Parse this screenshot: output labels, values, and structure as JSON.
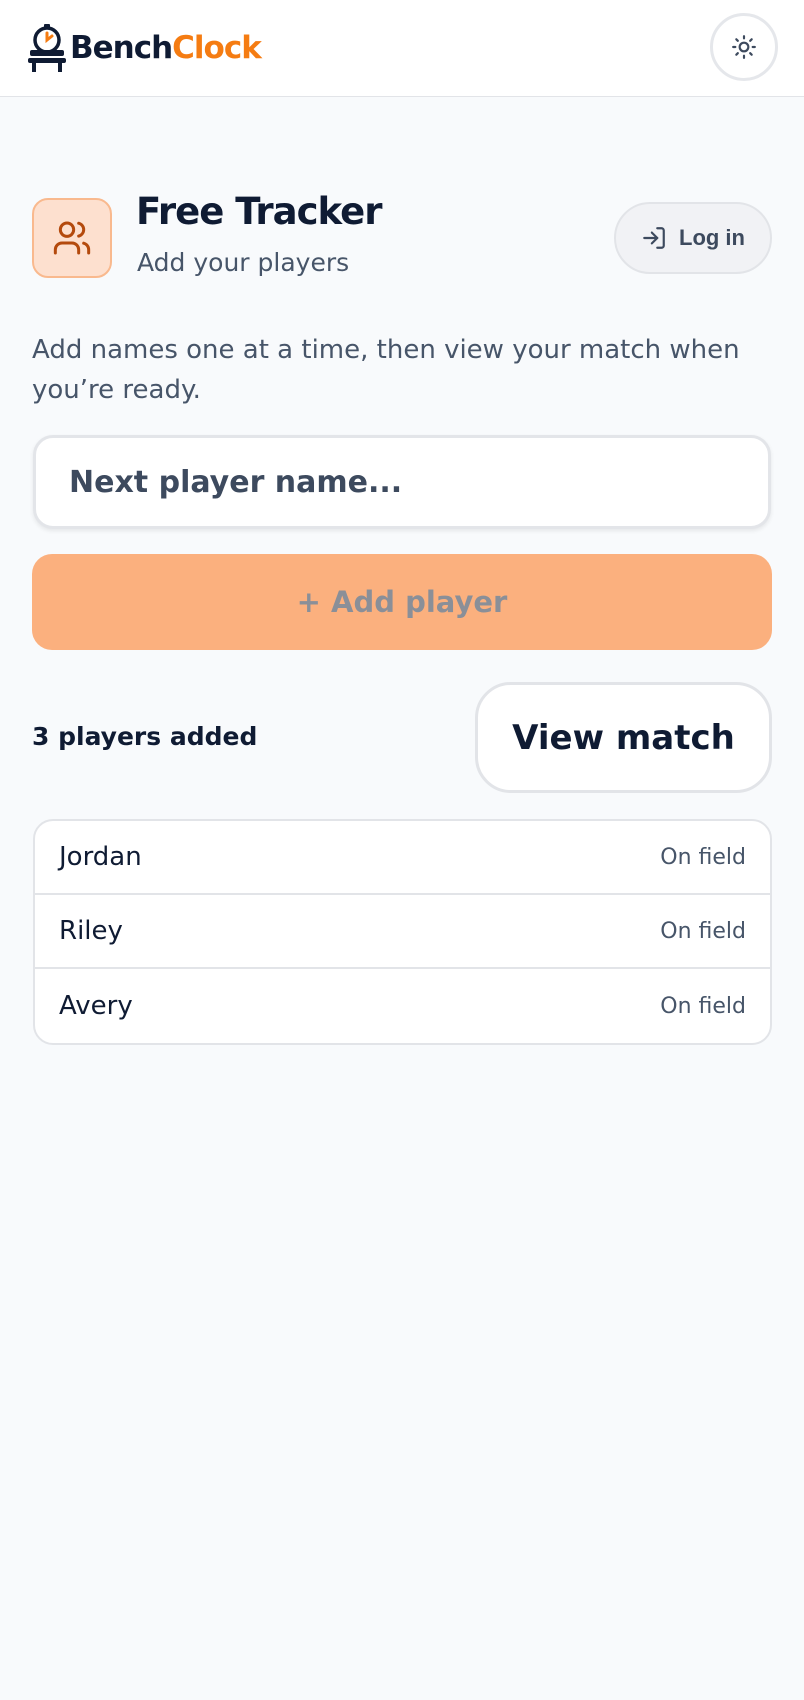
{
  "brand": {
    "part1": "Bench",
    "part2": "Clock"
  },
  "header": {
    "title": "Free Tracker",
    "subtitle": "Add your players",
    "login_label": "Log in"
  },
  "instructions": "Add names one at a time, then view your match when you’re ready.",
  "input": {
    "placeholder": "Next player name...",
    "value": ""
  },
  "add_button_label": "+ Add player",
  "player_count_label": "3 players added",
  "view_match_label": "View match",
  "players": [
    {
      "name": "Jordan",
      "status": "On field"
    },
    {
      "name": "Riley",
      "status": "On field"
    },
    {
      "name": "Avery",
      "status": "On field"
    }
  ],
  "colors": {
    "brand_dark": "#0f1b33",
    "brand_orange": "#f57c12",
    "add_button_bg": "#fbb07e",
    "tracker_icon_bg": "#fde0cf"
  },
  "icons": {
    "logo": "stopwatch-bench-icon",
    "theme_toggle": "sun-icon",
    "tracker": "users-icon",
    "login": "log-in-icon"
  }
}
